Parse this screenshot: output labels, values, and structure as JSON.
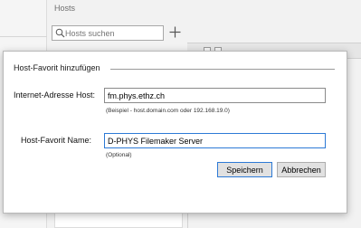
{
  "window": {
    "title": "Hosts"
  },
  "search": {
    "placeholder": "Hosts suchen",
    "value": ""
  },
  "toolbar": {
    "add_icon": "plus-icon",
    "search_icon": "magnifier-icon"
  },
  "dialog": {
    "group_title": "Host-Favorit hinzufügen",
    "address_label": "Internet-Adresse Host:",
    "address_value": "fm.phys.ethz.ch",
    "address_hint": "(Beispiel - host.domain.com oder 192.168.19.0)",
    "name_label": "Host-Favorit Name:",
    "name_value": "D-PHYS Filemaker Server",
    "name_hint": "(Optional)",
    "save_label": "Speichern",
    "cancel_label": "Abbrechen"
  },
  "colors": {
    "focus_border": "#2d7ad6",
    "dialog_bg": "#ffffff",
    "window_bg": "#f2f2f2"
  }
}
